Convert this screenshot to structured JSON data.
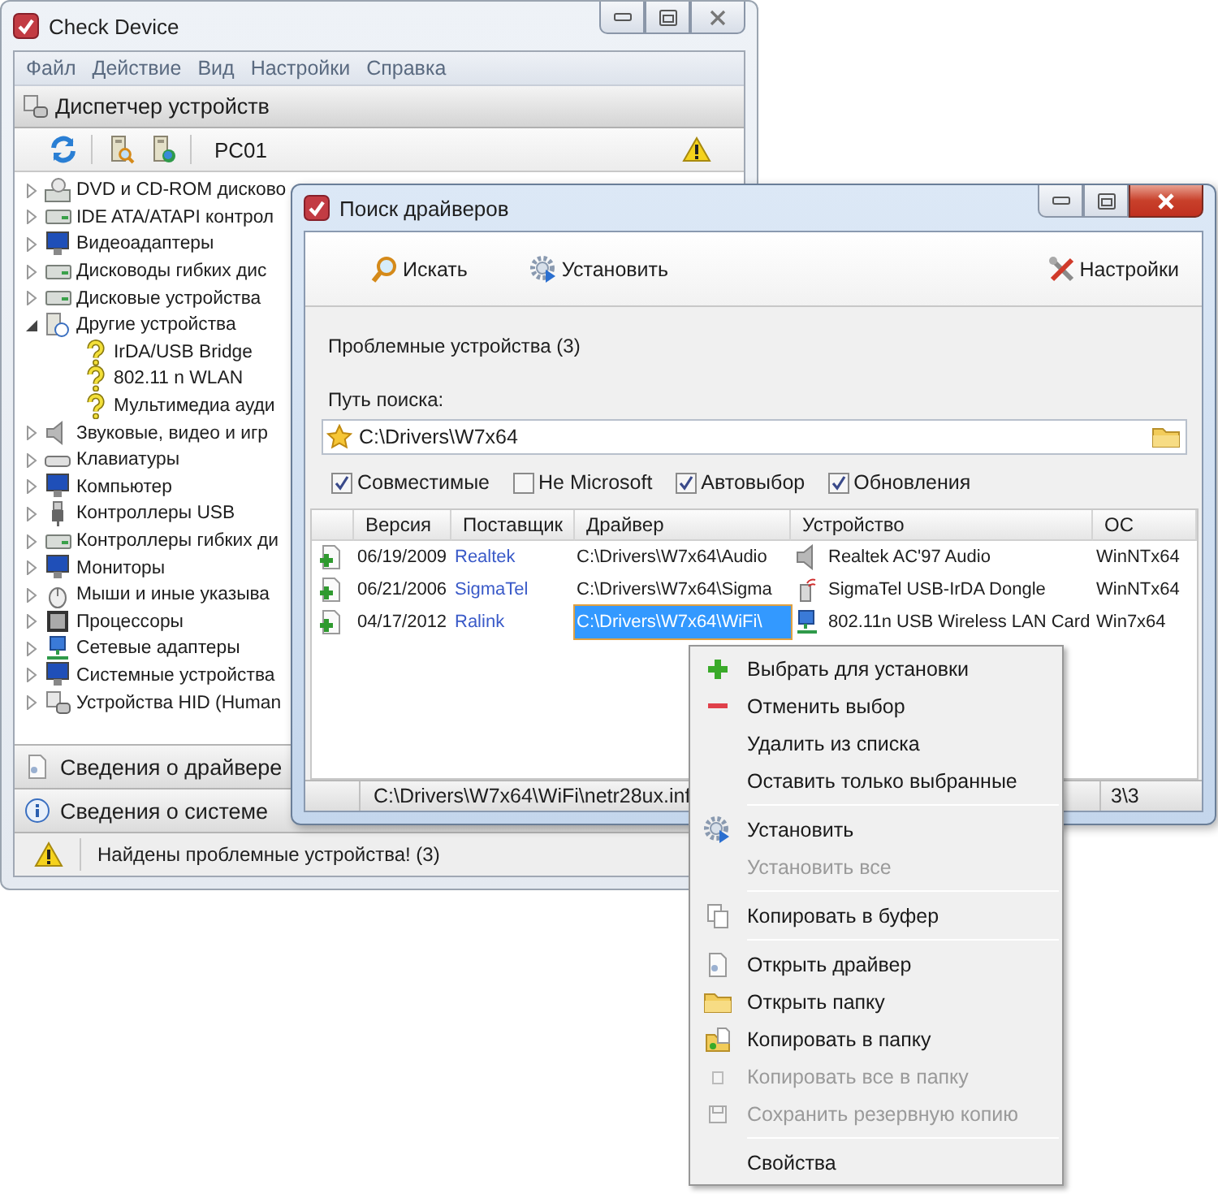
{
  "main_window": {
    "title": "Check Device",
    "menu": [
      "Файл",
      "Действие",
      "Вид",
      "Настройки",
      "Справка"
    ],
    "header": "Диспетчер устройств",
    "computer": "PC01",
    "tree": [
      {
        "label": "DVD и CD-ROM дисково",
        "expanded": false
      },
      {
        "label": "IDE ATA/ATAPI контрол",
        "expanded": false
      },
      {
        "label": "Видеоадаптеры",
        "expanded": false
      },
      {
        "label": "Дисководы гибких дис",
        "expanded": false
      },
      {
        "label": "Дисковые устройства",
        "expanded": false
      },
      {
        "label": "Другие устройства",
        "expanded": true,
        "children": [
          {
            "label": "IrDA/USB Bridge"
          },
          {
            "label": "802.11 n WLAN"
          },
          {
            "label": "Мультимедиа ауди"
          }
        ]
      },
      {
        "label": "Звуковые, видео и игр",
        "expanded": false
      },
      {
        "label": "Клавиатуры",
        "expanded": false
      },
      {
        "label": "Компьютер",
        "expanded": false
      },
      {
        "label": "Контроллеры USB",
        "expanded": false
      },
      {
        "label": "Контроллеры гибких ди",
        "expanded": false
      },
      {
        "label": "Мониторы",
        "expanded": false
      },
      {
        "label": "Мыши и иные указыва",
        "expanded": false
      },
      {
        "label": "Процессоры",
        "expanded": false
      },
      {
        "label": "Сетевые адаптеры",
        "expanded": false
      },
      {
        "label": "Системные устройства",
        "expanded": false
      },
      {
        "label": "Устройства HID (Human",
        "expanded": false
      }
    ],
    "panels": [
      "Сведения о драйвере",
      "Сведения о системе"
    ],
    "status_bar": "Найдены проблемные устройства! (3)"
  },
  "dialog": {
    "title": "Поиск драйверов",
    "toolbar": [
      "Искать",
      "Установить",
      "Настройки"
    ],
    "summary": "Проблемные устройства (3)",
    "search_path": {
      "label": "Путь поиска:",
      "value": "C:\\Drivers\\W7x64"
    },
    "options": [
      {
        "label": "Совместимые",
        "checked": true
      },
      {
        "label": "Не Microsoft",
        "checked": false
      },
      {
        "label": "Автовыбор",
        "checked": true
      },
      {
        "label": "Обновления",
        "checked": true
      }
    ],
    "table": {
      "columns": [
        "Версия",
        "Поставщик",
        "Драйвер",
        "Устройство",
        "ОС"
      ],
      "rows": [
        {
          "version": "06/19/2009",
          "vendor": "Realtek",
          "driver": "C:\\Drivers\\W7x64\\Audio",
          "device": "Realtek AC'97 Audio",
          "os": "WinNTx64",
          "selected": false
        },
        {
          "version": "06/21/2006",
          "vendor": "SigmaTel",
          "driver": "C:\\Drivers\\W7x64\\Sigma",
          "device": "SigmaTel USB-IrDA Dongle",
          "os": "WinNTx64",
          "selected": false
        },
        {
          "version": "04/17/2012",
          "vendor": "Ralink",
          "driver": "C:\\Drivers\\W7x64\\WiFi\\",
          "device": "802.11n USB Wireless LAN Card",
          "os": "Win7x64",
          "selected": true
        }
      ]
    },
    "status_bar": {
      "path": "C:\\Drivers\\W7x64\\WiFi\\netr28ux.inf",
      "count": "3\\3"
    }
  },
  "context_menu": [
    {
      "kind": "item",
      "label": "Выбрать для установки",
      "disabled": false
    },
    {
      "kind": "item",
      "label": "Отменить выбор",
      "disabled": false
    },
    {
      "kind": "item",
      "label": "Удалить из списка",
      "disabled": false
    },
    {
      "kind": "item",
      "label": "Оставить только выбранные",
      "disabled": false
    },
    {
      "kind": "separator"
    },
    {
      "kind": "item",
      "label": "Установить",
      "disabled": false
    },
    {
      "kind": "item",
      "label": "Установить все",
      "disabled": true
    },
    {
      "kind": "separator"
    },
    {
      "kind": "item",
      "label": "Копировать в буфер",
      "disabled": false
    },
    {
      "kind": "separator"
    },
    {
      "kind": "item",
      "label": "Открыть драйвер",
      "disabled": false
    },
    {
      "kind": "item",
      "label": "Открыть папку",
      "disabled": false
    },
    {
      "kind": "item",
      "label": "Копировать в папку",
      "disabled": false
    },
    {
      "kind": "item",
      "label": "Копировать все в папку",
      "disabled": true
    },
    {
      "kind": "item",
      "label": "Сохранить резервную копию",
      "disabled": true
    },
    {
      "kind": "separator"
    },
    {
      "kind": "item",
      "label": "Свойства",
      "disabled": false
    }
  ]
}
